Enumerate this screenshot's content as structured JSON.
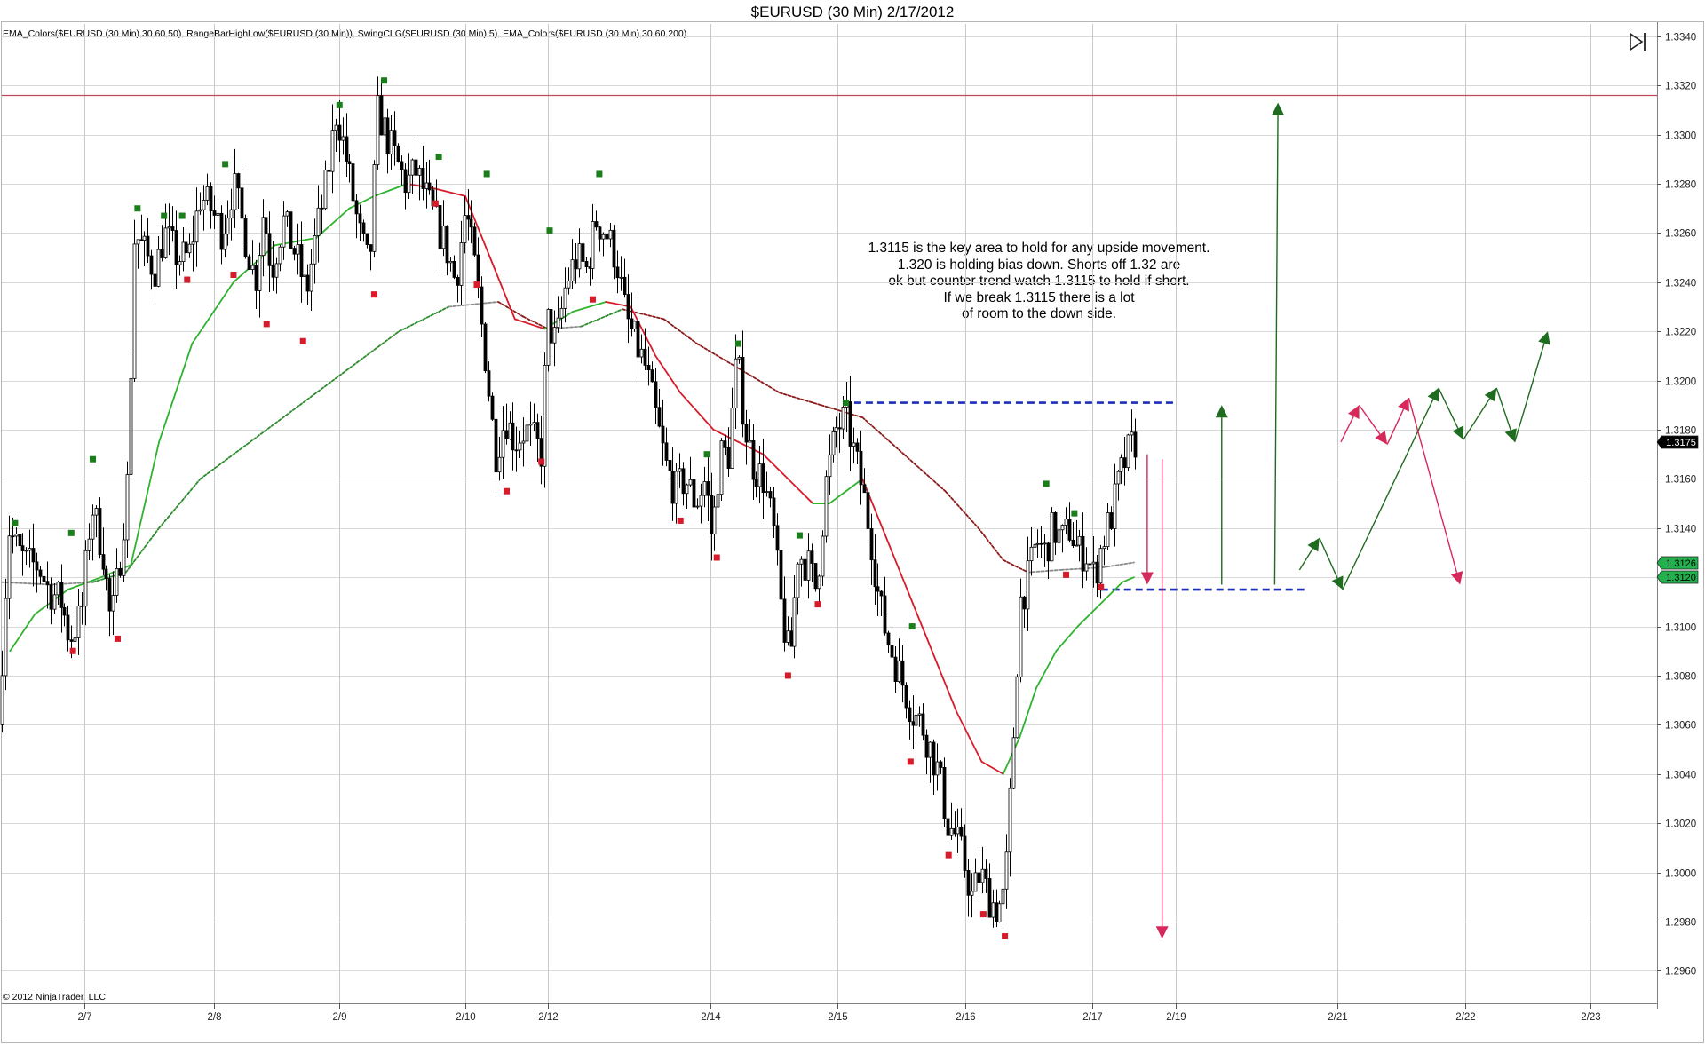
{
  "window": {
    "title": "$EURUSD (30 Min)  2/17/2012",
    "indicators": "EMA_Colors($EURUSD (30 Min),30,60,50), RangeBarHighLow($EURUSD (30 Min)), SwingCLG($EURUSD (30 Min),5), EMA_Colors($EURUSD (30 Min),30,60,200)",
    "copyright": "© 2012 NinjaTrader, LLC"
  },
  "annotation": {
    "lines": [
      "1.3115  is the key area to hold for any upside movement.",
      "1.320 is holding bias down. Shorts off 1.32 are",
      "ok but counter trend watch 1.3115 to hold if short.",
      "If we break 1.3115 there is a lot",
      "of room to the down side."
    ]
  },
  "price_tags": [
    {
      "value": "1.3175",
      "bg": "#000000",
      "fg": "#ffffff"
    },
    {
      "value": "1.3126",
      "bg": "#22b14c",
      "fg": "#000000"
    },
    {
      "value": "1.3120",
      "bg": "#22b14c",
      "fg": "#000000"
    }
  ],
  "colors": {
    "bullish": "#1a7f1a",
    "bearish": "#d81b2a",
    "ema50_up": "#2fb32f",
    "ema50_down": "#d81b2a",
    "ema200_up": "#2e8b2e",
    "ema200_down": "#8b1a1a",
    "ema200_flat": "#8a8a8a",
    "level_line": "#1c2fb8",
    "resistance_line": "#c0485a",
    "arrow_green": "#1f6b1f",
    "arrow_red": "#d6285a",
    "candle": "#000000",
    "grid": "#d8d8d8"
  },
  "chart_data": {
    "type": "candlestick",
    "symbol": "$EURUSD",
    "timeframe": "30 Min",
    "ylim": [
      1.295,
      1.3345
    ],
    "y_ticks": [
      "1.3340",
      "1.3320",
      "1.3300",
      "1.3280",
      "1.3260",
      "1.3240",
      "1.3220",
      "1.3200",
      "1.3180",
      "1.3160",
      "1.3140",
      "1.3120",
      "1.3100",
      "1.3080",
      "1.3060",
      "1.3040",
      "1.3020",
      "1.3000",
      "1.2980",
      "1.2960"
    ],
    "x_ticks": [
      {
        "label": "2/7",
        "pos": 0.05
      },
      {
        "label": "2/8",
        "pos": 0.128
      },
      {
        "label": "2/9",
        "pos": 0.204
      },
      {
        "label": "2/10",
        "pos": 0.28
      },
      {
        "label": "2/12",
        "pos": 0.33
      },
      {
        "label": "2/14",
        "pos": 0.428
      },
      {
        "label": "2/15",
        "pos": 0.505
      },
      {
        "label": "2/16",
        "pos": 0.582
      },
      {
        "label": "2/17",
        "pos": 0.659
      },
      {
        "label": "2/19",
        "pos": 0.709
      },
      {
        "label": "2/21",
        "pos": 0.807
      },
      {
        "label": "2/22",
        "pos": 0.884
      },
      {
        "label": "2/23",
        "pos": 0.96
      }
    ],
    "price_path": [
      [
        0.0,
        1.306
      ],
      [
        0.006,
        1.314
      ],
      [
        0.012,
        1.313
      ],
      [
        0.018,
        1.3125
      ],
      [
        0.024,
        1.3125
      ],
      [
        0.03,
        1.3115
      ],
      [
        0.038,
        1.311
      ],
      [
        0.043,
        1.3095
      ],
      [
        0.05,
        1.3105
      ],
      [
        0.056,
        1.315
      ],
      [
        0.063,
        1.313
      ],
      [
        0.068,
        1.31
      ],
      [
        0.073,
        1.3125
      ],
      [
        0.078,
        1.316
      ],
      [
        0.082,
        1.326
      ],
      [
        0.09,
        1.325
      ],
      [
        0.095,
        1.3245
      ],
      [
        0.1,
        1.326
      ],
      [
        0.108,
        1.325
      ],
      [
        0.115,
        1.325
      ],
      [
        0.122,
        1.3275
      ],
      [
        0.128,
        1.327
      ],
      [
        0.135,
        1.326
      ],
      [
        0.142,
        1.328
      ],
      [
        0.15,
        1.3255
      ],
      [
        0.155,
        1.324
      ],
      [
        0.16,
        1.327
      ],
      [
        0.165,
        1.3245
      ],
      [
        0.172,
        1.3265
      ],
      [
        0.18,
        1.325
      ],
      [
        0.186,
        1.3235
      ],
      [
        0.192,
        1.326
      ],
      [
        0.198,
        1.328
      ],
      [
        0.204,
        1.331
      ],
      [
        0.21,
        1.329
      ],
      [
        0.218,
        1.326
      ],
      [
        0.224,
        1.3245
      ],
      [
        0.229,
        1.331
      ],
      [
        0.234,
        1.33
      ],
      [
        0.24,
        1.329
      ],
      [
        0.246,
        1.328
      ],
      [
        0.252,
        1.3285
      ],
      [
        0.258,
        1.3275
      ],
      [
        0.264,
        1.3265
      ],
      [
        0.27,
        1.3255
      ],
      [
        0.276,
        1.324
      ],
      [
        0.282,
        1.327
      ],
      [
        0.288,
        1.3245
      ],
      [
        0.294,
        1.321
      ],
      [
        0.3,
        1.317
      ],
      [
        0.306,
        1.3185
      ],
      [
        0.312,
        1.3175
      ],
      [
        0.318,
        1.318
      ],
      [
        0.324,
        1.3175
      ],
      [
        0.328,
        1.317
      ],
      [
        0.331,
        1.3225
      ],
      [
        0.337,
        1.3215
      ],
      [
        0.343,
        1.324
      ],
      [
        0.349,
        1.325
      ],
      [
        0.355,
        1.3245
      ],
      [
        0.361,
        1.3265
      ],
      [
        0.367,
        1.326
      ],
      [
        0.373,
        1.325
      ],
      [
        0.379,
        1.3225
      ],
      [
        0.385,
        1.3215
      ],
      [
        0.391,
        1.3205
      ],
      [
        0.397,
        1.3185
      ],
      [
        0.403,
        1.3165
      ],
      [
        0.409,
        1.3155
      ],
      [
        0.415,
        1.316
      ],
      [
        0.421,
        1.315
      ],
      [
        0.427,
        1.316
      ],
      [
        0.431,
        1.3135
      ],
      [
        0.436,
        1.317
      ],
      [
        0.441,
        1.317
      ],
      [
        0.446,
        1.321
      ],
      [
        0.451,
        1.318
      ],
      [
        0.456,
        1.3165
      ],
      [
        0.462,
        1.316
      ],
      [
        0.468,
        1.314
      ],
      [
        0.473,
        1.3105
      ],
      [
        0.478,
        1.3085
      ],
      [
        0.483,
        1.313
      ],
      [
        0.489,
        1.3125
      ],
      [
        0.494,
        1.3115
      ],
      [
        0.5,
        1.316
      ],
      [
        0.506,
        1.318
      ],
      [
        0.512,
        1.3185
      ],
      [
        0.517,
        1.317
      ],
      [
        0.522,
        1.3155
      ],
      [
        0.527,
        1.3135
      ],
      [
        0.532,
        1.311
      ],
      [
        0.537,
        1.3095
      ],
      [
        0.542,
        1.3085
      ],
      [
        0.547,
        1.3075
      ],
      [
        0.552,
        1.3065
      ],
      [
        0.558,
        1.306
      ],
      [
        0.563,
        1.305
      ],
      [
        0.568,
        1.304
      ],
      [
        0.573,
        1.302
      ],
      [
        0.578,
        1.3015
      ],
      [
        0.583,
        1.3005
      ],
      [
        0.588,
        1.299
      ],
      [
        0.593,
        1.3
      ],
      [
        0.598,
        1.299
      ],
      [
        0.603,
        1.2985
      ],
      [
        0.608,
        1.299
      ],
      [
        0.612,
        1.304
      ],
      [
        0.617,
        1.311
      ],
      [
        0.622,
        1.312
      ],
      [
        0.627,
        1.3135
      ],
      [
        0.632,
        1.313
      ],
      [
        0.637,
        1.314
      ],
      [
        0.642,
        1.3135
      ],
      [
        0.647,
        1.314
      ],
      [
        0.652,
        1.313
      ],
      [
        0.657,
        1.313
      ],
      [
        0.662,
        1.312
      ],
      [
        0.667,
        1.3135
      ],
      [
        0.672,
        1.3145
      ],
      [
        0.677,
        1.316
      ],
      [
        0.682,
        1.317
      ],
      [
        0.686,
        1.3175
      ]
    ],
    "ema50": [
      [
        0.005,
        1.309
      ],
      [
        0.02,
        1.3105
      ],
      [
        0.04,
        1.3115
      ],
      [
        0.06,
        1.312
      ],
      [
        0.078,
        1.3125
      ],
      [
        0.095,
        1.3175
      ],
      [
        0.115,
        1.3215
      ],
      [
        0.14,
        1.324
      ],
      [
        0.165,
        1.3255
      ],
      [
        0.19,
        1.3258
      ],
      [
        0.21,
        1.327
      ],
      [
        0.225,
        1.3275
      ],
      [
        0.245,
        1.328
      ],
      [
        0.262,
        1.3278
      ],
      [
        0.28,
        1.3275
      ],
      [
        0.295,
        1.325
      ],
      [
        0.31,
        1.3225
      ],
      [
        0.328,
        1.3221
      ],
      [
        0.345,
        1.3228
      ],
      [
        0.365,
        1.3232
      ],
      [
        0.38,
        1.323
      ],
      [
        0.395,
        1.321
      ],
      [
        0.41,
        1.3195
      ],
      [
        0.43,
        1.318
      ],
      [
        0.445,
        1.3175
      ],
      [
        0.46,
        1.317
      ],
      [
        0.475,
        1.316
      ],
      [
        0.49,
        1.315
      ],
      [
        0.5,
        1.315
      ],
      [
        0.51,
        1.3155
      ],
      [
        0.52,
        1.316
      ],
      [
        0.532,
        1.314
      ],
      [
        0.547,
        1.3115
      ],
      [
        0.562,
        1.309
      ],
      [
        0.577,
        1.3065
      ],
      [
        0.592,
        1.3045
      ],
      [
        0.605,
        1.304
      ],
      [
        0.615,
        1.3055
      ],
      [
        0.625,
        1.3075
      ],
      [
        0.637,
        1.309
      ],
      [
        0.65,
        1.31
      ],
      [
        0.665,
        1.311
      ],
      [
        0.677,
        1.3118
      ],
      [
        0.684,
        1.312
      ]
    ],
    "ema200": [
      [
        0.0,
        1.3118
      ],
      [
        0.03,
        1.3117
      ],
      [
        0.055,
        1.3118
      ],
      [
        0.075,
        1.3122
      ],
      [
        0.095,
        1.314
      ],
      [
        0.12,
        1.316
      ],
      [
        0.15,
        1.3175
      ],
      [
        0.18,
        1.319
      ],
      [
        0.21,
        1.3205
      ],
      [
        0.24,
        1.322
      ],
      [
        0.27,
        1.323
      ],
      [
        0.3,
        1.3232
      ],
      [
        0.315,
        1.3226
      ],
      [
        0.33,
        1.3221
      ],
      [
        0.35,
        1.3222
      ],
      [
        0.375,
        1.3229
      ],
      [
        0.4,
        1.3225
      ],
      [
        0.42,
        1.3215
      ],
      [
        0.445,
        1.3205
      ],
      [
        0.47,
        1.3195
      ],
      [
        0.495,
        1.319
      ],
      [
        0.52,
        1.3185
      ],
      [
        0.545,
        1.317
      ],
      [
        0.57,
        1.3155
      ],
      [
        0.59,
        1.314
      ],
      [
        0.605,
        1.3127
      ],
      [
        0.62,
        1.3122
      ],
      [
        0.64,
        1.3123
      ],
      [
        0.665,
        1.3124
      ],
      [
        0.684,
        1.3126
      ]
    ],
    "swing_highs": [
      [
        0.008,
        1.3142
      ],
      [
        0.042,
        1.3138
      ],
      [
        0.055,
        1.3168
      ],
      [
        0.082,
        1.327
      ],
      [
        0.098,
        1.3267
      ],
      [
        0.109,
        1.3267
      ],
      [
        0.135,
        1.3288
      ],
      [
        0.204,
        1.3312
      ],
      [
        0.231,
        1.3322
      ],
      [
        0.264,
        1.3291
      ],
      [
        0.293,
        1.3284
      ],
      [
        0.331,
        1.3261
      ],
      [
        0.361,
        1.3284
      ],
      [
        0.426,
        1.317
      ],
      [
        0.445,
        1.3215
      ],
      [
        0.482,
        1.3137
      ],
      [
        0.51,
        1.3191
      ],
      [
        0.55,
        1.31
      ],
      [
        0.631,
        1.3158
      ],
      [
        0.648,
        1.3146
      ]
    ],
    "swing_lows": [
      [
        0.043,
        1.309
      ],
      [
        0.07,
        1.3095
      ],
      [
        0.112,
        1.3241
      ],
      [
        0.14,
        1.3243
      ],
      [
        0.16,
        1.3223
      ],
      [
        0.182,
        1.3216
      ],
      [
        0.225,
        1.3235
      ],
      [
        0.262,
        1.3272
      ],
      [
        0.287,
        1.3239
      ],
      [
        0.305,
        1.3155
      ],
      [
        0.326,
        1.3167
      ],
      [
        0.357,
        1.3233
      ],
      [
        0.41,
        1.3143
      ],
      [
        0.432,
        1.3128
      ],
      [
        0.475,
        1.308
      ],
      [
        0.493,
        1.3109
      ],
      [
        0.549,
        1.3045
      ],
      [
        0.572,
        1.3007
      ],
      [
        0.593,
        1.2983
      ],
      [
        0.606,
        1.2974
      ],
      [
        0.643,
        1.3121
      ],
      [
        0.664,
        1.3116
      ]
    ],
    "level_1_3191": {
      "value": 1.3191,
      "x_from": 0.508,
      "x_to": 0.71
    },
    "level_1_3115": {
      "value": 1.3115,
      "x_from": 0.664,
      "x_to": 0.788
    },
    "resistance_1_3316": {
      "value": 1.3316
    },
    "arrows": [
      {
        "color": "red",
        "x1": 0.692,
        "y1": 1.317,
        "x2": 0.692,
        "y2": 1.3117
      },
      {
        "color": "red",
        "x1": 0.701,
        "y1": 1.3168,
        "x2": 0.701,
        "y2": 1.2973
      },
      {
        "color": "green",
        "x1": 0.737,
        "y1": 1.3117,
        "x2": 0.737,
        "y2": 1.319
      },
      {
        "color": "green",
        "x1": 0.769,
        "y1": 1.3117,
        "x2": 0.771,
        "y2": 1.3313
      },
      {
        "color": "green",
        "x1": 0.784,
        "y1": 1.3123,
        "x2": 0.796,
        "y2": 1.3136
      },
      {
        "color": "green",
        "x1": 0.796,
        "y1": 1.3136,
        "x2": 0.81,
        "y2": 1.3115
      },
      {
        "color": "green",
        "x1": 0.81,
        "y1": 1.3115,
        "x2": 0.868,
        "y2": 1.3197
      },
      {
        "color": "green",
        "x1": 0.868,
        "y1": 1.3197,
        "x2": 0.883,
        "y2": 1.3176
      },
      {
        "color": "green",
        "x1": 0.883,
        "y1": 1.3176,
        "x2": 0.903,
        "y2": 1.3197
      },
      {
        "color": "green",
        "x1": 0.903,
        "y1": 1.3197,
        "x2": 0.914,
        "y2": 1.3175
      },
      {
        "color": "green",
        "x1": 0.914,
        "y1": 1.3175,
        "x2": 0.934,
        "y2": 1.322
      },
      {
        "color": "red",
        "x1": 0.809,
        "y1": 1.3175,
        "x2": 0.82,
        "y2": 1.319
      },
      {
        "color": "red",
        "x1": 0.82,
        "y1": 1.319,
        "x2": 0.837,
        "y2": 1.3174
      },
      {
        "color": "red",
        "x1": 0.837,
        "y1": 1.3174,
        "x2": 0.85,
        "y2": 1.3193
      },
      {
        "color": "red",
        "x1": 0.85,
        "y1": 1.3193,
        "x2": 0.881,
        "y2": 1.3117
      }
    ]
  }
}
